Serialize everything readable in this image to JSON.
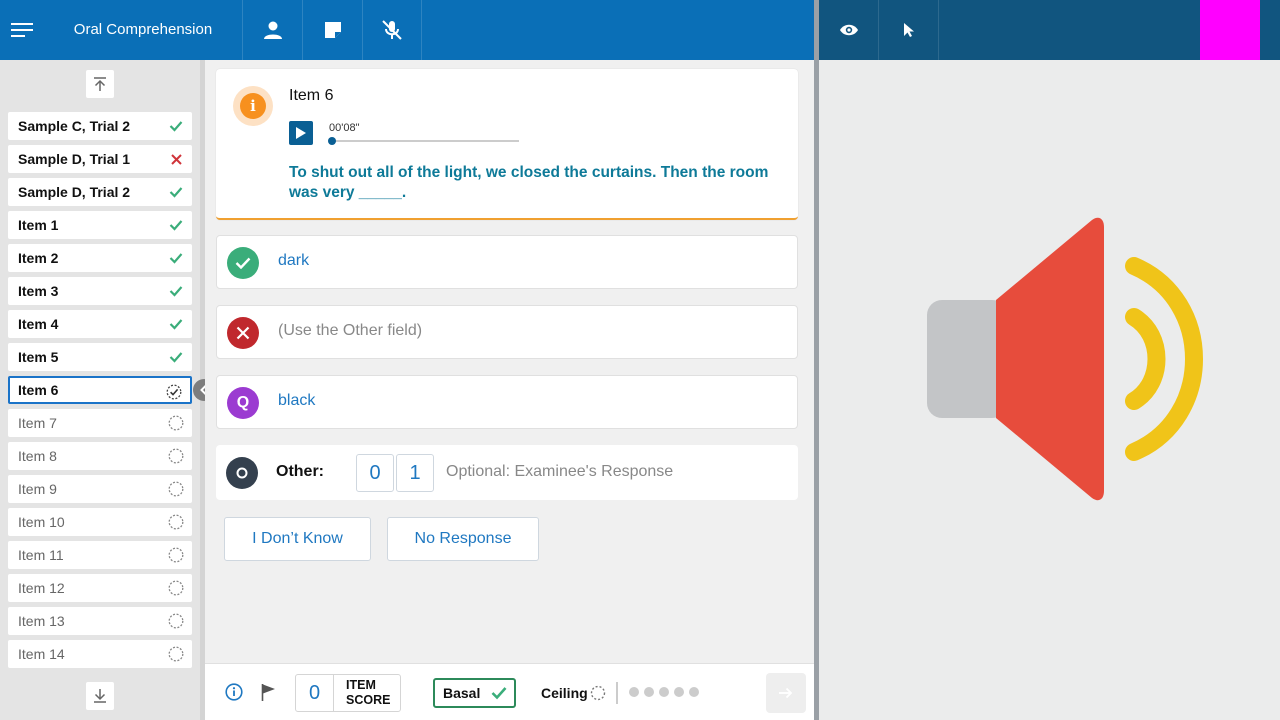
{
  "header": {
    "title": "Oral Comprehension",
    "icons": [
      "menu-icon",
      "user-icon",
      "note-icon",
      "mic-off-icon",
      "eye-icon",
      "cursor-icon"
    ]
  },
  "sidebar": {
    "items": [
      {
        "label": "Sample C, Trial 2",
        "status": "correct"
      },
      {
        "label": "Sample D, Trial 1",
        "status": "incorrect"
      },
      {
        "label": "Sample D, Trial 2",
        "status": "correct"
      },
      {
        "label": "Item 1",
        "status": "correct"
      },
      {
        "label": "Item 2",
        "status": "correct"
      },
      {
        "label": "Item 3",
        "status": "correct"
      },
      {
        "label": "Item 4",
        "status": "correct"
      },
      {
        "label": "Item 5",
        "status": "correct"
      },
      {
        "label": "Item 6",
        "status": "current"
      },
      {
        "label": "Item 7",
        "status": "pending"
      },
      {
        "label": "Item 8",
        "status": "pending"
      },
      {
        "label": "Item 9",
        "status": "pending"
      },
      {
        "label": "Item 10",
        "status": "pending"
      },
      {
        "label": "Item 11",
        "status": "pending"
      },
      {
        "label": "Item 12",
        "status": "pending"
      },
      {
        "label": "Item 13",
        "status": "pending"
      },
      {
        "label": "Item 14",
        "status": "pending"
      }
    ]
  },
  "question": {
    "title": "Item 6",
    "audio_time": "00'08\"",
    "prompt": "To shut out all of the light, we closed the curtains. Then the room was very _____."
  },
  "responses": [
    {
      "label": "dark",
      "type": "correct",
      "color": "#3aad7a"
    },
    {
      "label": "(Use the Other field)",
      "type": "incorrect",
      "color": "#c0282d"
    },
    {
      "label": "black",
      "type": "query",
      "badge": "Q",
      "color": "#9b3bd1"
    }
  ],
  "other": {
    "label": "Other:",
    "scores": [
      "0",
      "1"
    ],
    "placeholder": "Optional: Examinee's Response"
  },
  "buttons": {
    "dont_know": "I Don’t Know",
    "no_response": "No Response"
  },
  "footer": {
    "item_score_value": "0",
    "item_score_label_1": "ITEM",
    "item_score_label_2": "SCORE",
    "basal_label": "Basal",
    "ceiling_label": "Ceiling"
  },
  "colors": {
    "topbar": "#0a6fb7",
    "topbar_right": "#11557f",
    "accent": "#1f78c1",
    "correct": "#3aad7a",
    "incorrect": "#c0282d",
    "magenta": "#ff00ff"
  }
}
